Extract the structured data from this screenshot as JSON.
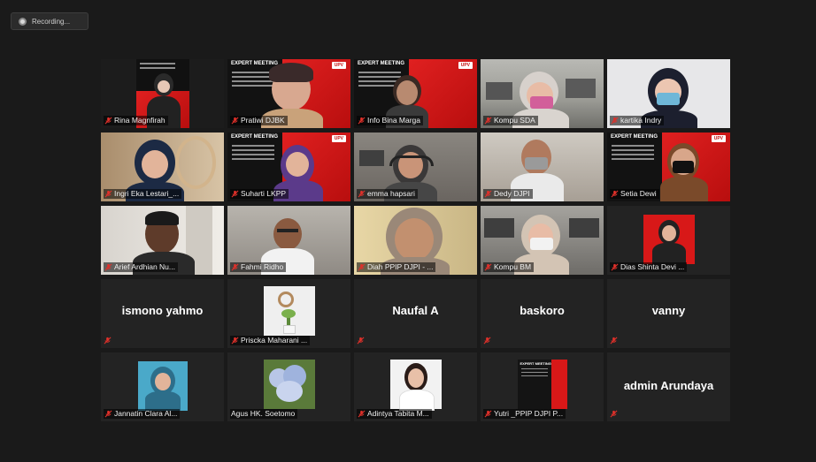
{
  "recording": {
    "label": "Recording..."
  },
  "slide_text": {
    "header": "EXPERT MEETING",
    "logo": "UPV"
  },
  "participants": [
    {
      "name": "Rina Magnfirah"
    },
    {
      "name": "Pratiwi DJBK"
    },
    {
      "name": "Info Bina Marga"
    },
    {
      "name": "Kompu SDA"
    },
    {
      "name": "kartika Indry"
    },
    {
      "name": "Ingri Eka Lestari_..."
    },
    {
      "name": "Suharti LKPP"
    },
    {
      "name": "emma hapsari"
    },
    {
      "name": "Dedy DJPI"
    },
    {
      "name": "Setia Dewi"
    },
    {
      "name": "Arief Ardhian Nu..."
    },
    {
      "name": "Fahmi Ridho"
    },
    {
      "name": "Diah PPIP DJPI - ..."
    },
    {
      "name": "Kompu BM"
    },
    {
      "name": "Dias Shinta Devi ..."
    },
    {
      "name": "ismono yahmo"
    },
    {
      "name": "Priscka Maharani ..."
    },
    {
      "name": "Naufal A"
    },
    {
      "name": "baskoro"
    },
    {
      "name": "vanny"
    },
    {
      "name": "Jannatin Clara Al..."
    },
    {
      "name": "Agus HK. Soetomo"
    },
    {
      "name": "Adintya Tabita M..."
    },
    {
      "name": "Yutri _PPIP DJPI P..."
    },
    {
      "name": "admin Arundaya"
    }
  ],
  "colors": {
    "mic_muted": "#e0302a",
    "slide_red": "#d81818"
  }
}
